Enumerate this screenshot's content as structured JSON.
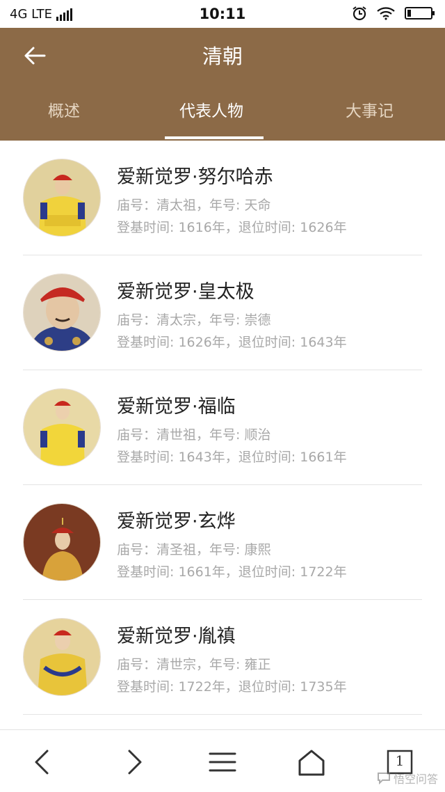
{
  "status_bar": {
    "network": "4G LTE",
    "time": "10:11"
  },
  "header": {
    "title": "清朝",
    "tabs": [
      {
        "label": "概述",
        "active": false
      },
      {
        "label": "代表人物",
        "active": true
      },
      {
        "label": "大事记",
        "active": false
      }
    ]
  },
  "figures": [
    {
      "name": "爱新觉罗·努尔哈赤",
      "temple": "庙号：清太祖，年号: 天命",
      "reign": "登基时间: 1616年，退位时间: 1626年"
    },
    {
      "name": "爱新觉罗·皇太极",
      "temple": "庙号：清太宗，年号: 崇德",
      "reign": "登基时间: 1626年，退位时间: 1643年"
    },
    {
      "name": "爱新觉罗·福临",
      "temple": "庙号：清世祖，年号: 顺治",
      "reign": "登基时间: 1643年，退位时间: 1661年"
    },
    {
      "name": "爱新觉罗·玄烨",
      "temple": "庙号：清圣祖，年号: 康熙",
      "reign": "登基时间: 1661年，退位时间: 1722年"
    },
    {
      "name": "爱新觉罗·胤禛",
      "temple": "庙号：清世宗，年号: 雍正",
      "reign": "登基时间: 1722年，退位时间: 1735年"
    }
  ],
  "bottom_bar": {
    "tab_count": "1",
    "watermark": "悟空问答"
  },
  "colors": {
    "header_bg": "#8c6a47",
    "tab_inactive": "#e6d6c2",
    "secondary_text": "#a8a8a8"
  }
}
